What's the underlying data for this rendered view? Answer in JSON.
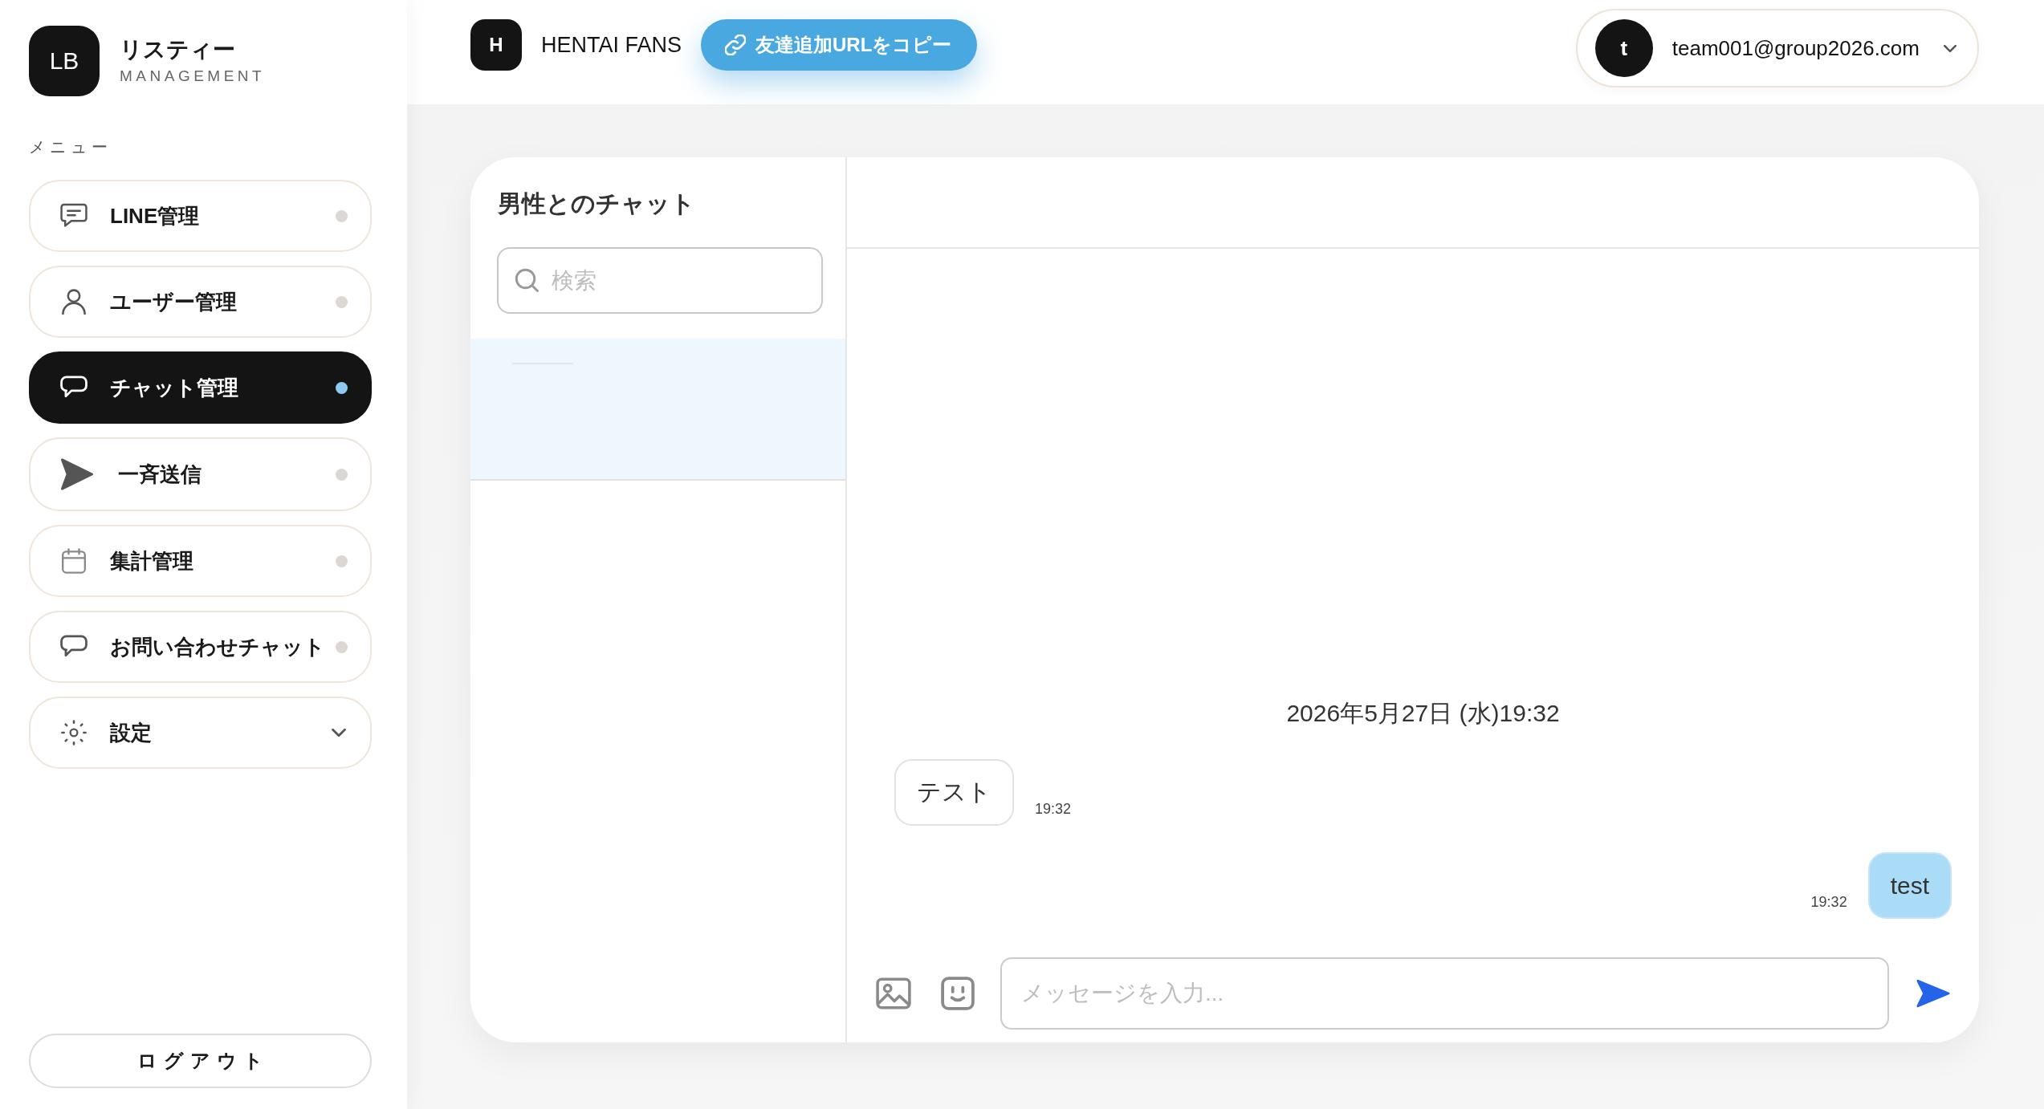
{
  "sidebar": {
    "logo": {
      "mark": "LB",
      "title": "リスティー",
      "subtitle": "MANAGEMENT"
    },
    "menu_heading": "メニュー",
    "items": [
      {
        "kind": "link",
        "label": "LINE管理",
        "selected": false
      },
      {
        "kind": "link",
        "label": "ユーザー管理",
        "selected": false
      },
      {
        "kind": "link",
        "label": "チャット管理",
        "selected": true
      },
      {
        "kind": "link",
        "label": "一斉送信",
        "selected": false
      },
      {
        "kind": "link",
        "label": "集計管理",
        "selected": false
      },
      {
        "kind": "link",
        "label": "お問い合わせチャット",
        "selected": false
      },
      {
        "kind": "group",
        "label": "設定",
        "selected": false,
        "expanded": false
      }
    ],
    "logout": "ログアウト"
  },
  "header": {
    "account": {
      "mark": "H",
      "name": "HENTAI FANS"
    },
    "copy_button": "友達追加URLをコピー",
    "user": {
      "initial": "t",
      "email": "team001@group2026.com"
    }
  },
  "chat": {
    "list_title": "男性とのチャット",
    "search": {
      "placeholder": "検索"
    },
    "conversations": [
      {
        "selected": true
      }
    ],
    "thread": {
      "date": "2026年5月27日 (水)19:32",
      "messages": [
        {
          "kind": "received",
          "text": "テスト",
          "time": "19:32"
        },
        {
          "kind": "sent",
          "text": "test",
          "time": "19:32"
        }
      ],
      "composer": {
        "placeholder": "メッセージを入力..."
      }
    }
  }
}
